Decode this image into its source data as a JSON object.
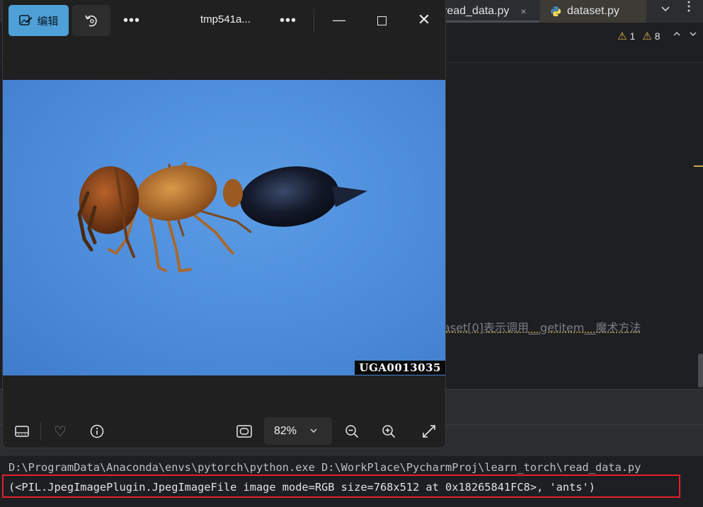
{
  "ide": {
    "tabs": [
      {
        "label": "read_data.py",
        "close": "×"
      },
      {
        "label": "dataset.py"
      }
    ],
    "tab_overflow_icon": "chevron-down-icon",
    "tab_menu_icon": "kebab-icon",
    "inspections": {
      "warnings": "1",
      "weak_warnings": "8"
    },
    "code_comment": "aset[0]表示调用__getitem__魔术方法",
    "console": {
      "command": "D:\\ProgramData\\Anaconda\\envs\\pytorch\\python.exe D:\\WorkPlace\\PycharmProj\\learn_torch\\read_data.py",
      "output": "(<PIL.JpegImagePlugin.JpegImageFile image mode=RGB size=768x512 at 0x18265841FC8>, 'ants')"
    },
    "colors": {
      "highlight_box": "#e0202a",
      "accent": "#c9a94b"
    }
  },
  "viewer": {
    "edit_label": "编辑",
    "file_title": "tmp541a...",
    "more_label": "•••",
    "minimize": "—",
    "close": "✕",
    "watermark": "UGA0013035",
    "zoom_value": "82%",
    "zoom_chevron": "⌄",
    "favorite": "♡",
    "colors": {
      "edit_button": "#4ea0d7",
      "photo_background": "#4a8cdc"
    }
  }
}
